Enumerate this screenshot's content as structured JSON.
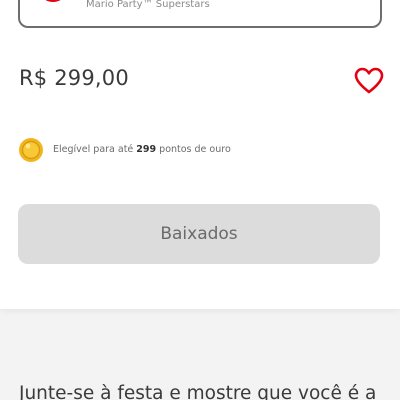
{
  "edition": {
    "name": "Mario Party™ Superstars"
  },
  "product": {
    "price": "R$ 299,00"
  },
  "rewards": {
    "text_before": "Elegível para até ",
    "points": "299",
    "text_after": " pontos de ouro"
  },
  "actions": {
    "download_label": "Baixados"
  },
  "description": {
    "text": "Junte-se à festa e mostre que você é a"
  },
  "colors": {
    "accent_red": "#e60012",
    "coin_gold": "#f2b51f",
    "button_disabled_bg": "#dcdcdc",
    "page_bg": "#f3f3f3"
  },
  "icons": {
    "wishlist": "heart-outline-icon",
    "rewards": "gold-coin-icon"
  }
}
